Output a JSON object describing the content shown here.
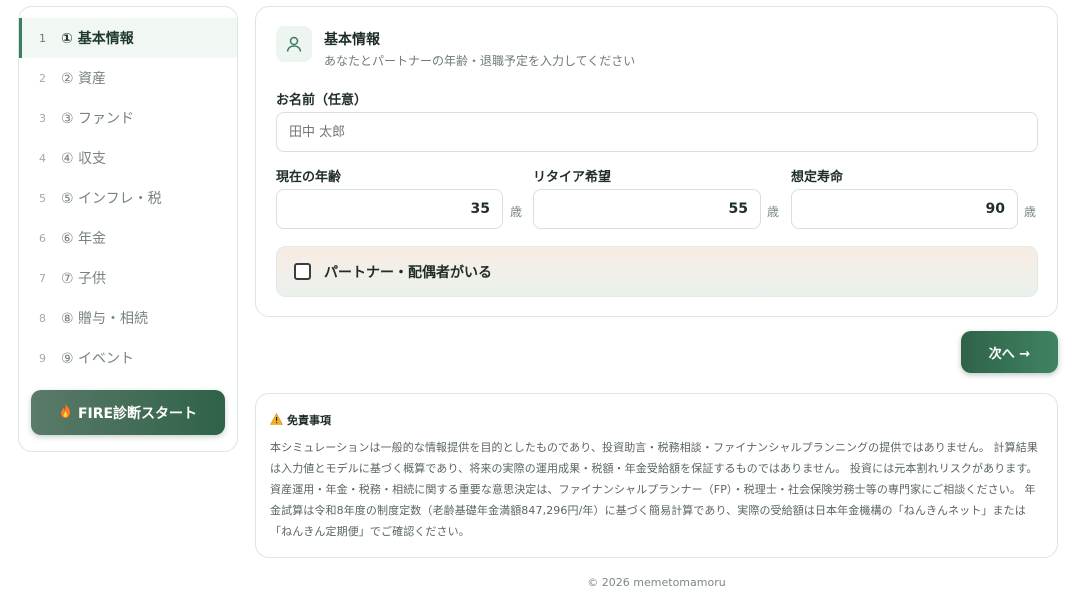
{
  "sidebar": {
    "items": [
      {
        "num": "1",
        "label": "① 基本情報"
      },
      {
        "num": "2",
        "label": "② 資産"
      },
      {
        "num": "3",
        "label": "③ ファンド"
      },
      {
        "num": "4",
        "label": "④ 収支"
      },
      {
        "num": "5",
        "label": "⑤ インフレ・税"
      },
      {
        "num": "6",
        "label": "⑥ 年金"
      },
      {
        "num": "7",
        "label": "⑦ 子供"
      },
      {
        "num": "8",
        "label": "⑧ 贈与・相続"
      },
      {
        "num": "9",
        "label": "⑨ イベント"
      }
    ],
    "fire_button": "FIRE診断スタート"
  },
  "basic": {
    "title": "基本情報",
    "subtitle": "あなたとパートナーの年齢・退職予定を入力してください",
    "name_label": "お名前（任意）",
    "name_placeholder": "田中 太郎",
    "age_label": "現在の年齢",
    "age_value": "35",
    "retire_label": "リタイア希望",
    "retire_value": "55",
    "life_label": "想定寿命",
    "life_value": "90",
    "unit": "歳",
    "partner_label": "パートナー・配偶者がいる"
  },
  "next_button": "次へ →",
  "disclaimer": {
    "title": "免責事項",
    "body": "本シミュレーションは一般的な情報提供を目的としたものであり、投資助言・税務相談・ファイナンシャルプランニングの提供ではありません。 計算結果は入力値とモデルに基づく概算であり、将来の実際の運用成果・税額・年金受給額を保証するものではありません。 投資には元本割れリスクがあります。資産運用・年金・税務・相続に関する重要な意思決定は、ファイナンシャルプランナー（FP）・税理士・社会保険労務士等の専門家にご相談ください。 年金試算は令和8年度の制度定数（老齢基礎年金満額847,296円/年）に基づく簡易計算であり、実際の受給額は日本年金機構の「ねんきんネット」または「ねんきん定期便」でご確認ください。"
  },
  "footer": "© 2026 memetomamoru"
}
